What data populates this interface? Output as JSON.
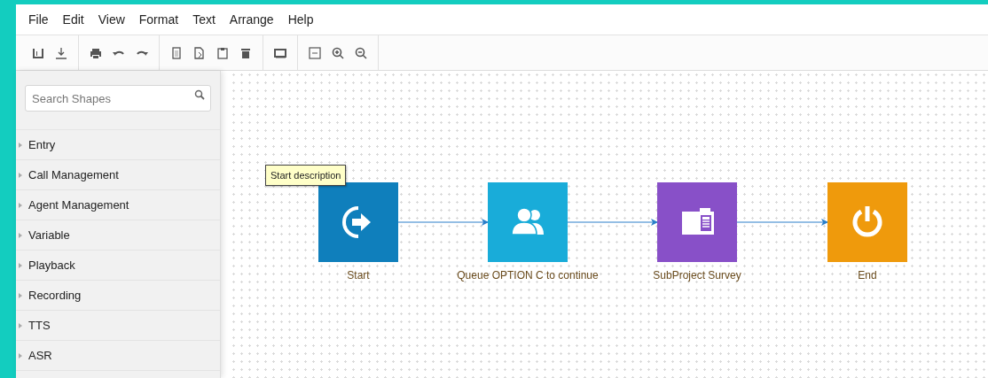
{
  "menu": [
    "File",
    "Edit",
    "View",
    "Format",
    "Text",
    "Arrange",
    "Help"
  ],
  "sidebar": {
    "search": {
      "placeholder": "Search Shapes"
    },
    "categories": [
      {
        "label": "Entry",
        "expanded": false
      },
      {
        "label": "Call Management",
        "expanded": false
      },
      {
        "label": "Agent Management",
        "expanded": false
      },
      {
        "label": "Variable",
        "expanded": false
      },
      {
        "label": "Playback",
        "expanded": false
      },
      {
        "label": "Recording",
        "expanded": false
      },
      {
        "label": "TTS",
        "expanded": false
      },
      {
        "label": "ASR",
        "expanded": false
      }
    ]
  },
  "diagram": {
    "tooltip": "Start description",
    "nodes": [
      {
        "kind": "start",
        "label": "Start",
        "color": "#0f7fbc"
      },
      {
        "kind": "queue",
        "label": "Queue OPTION C to continue",
        "color": "#19acd9"
      },
      {
        "kind": "subproject",
        "label": "SubProject Survey",
        "color": "#8850c8"
      },
      {
        "kind": "end",
        "label": "End",
        "color": "#ef9a0c"
      }
    ]
  }
}
